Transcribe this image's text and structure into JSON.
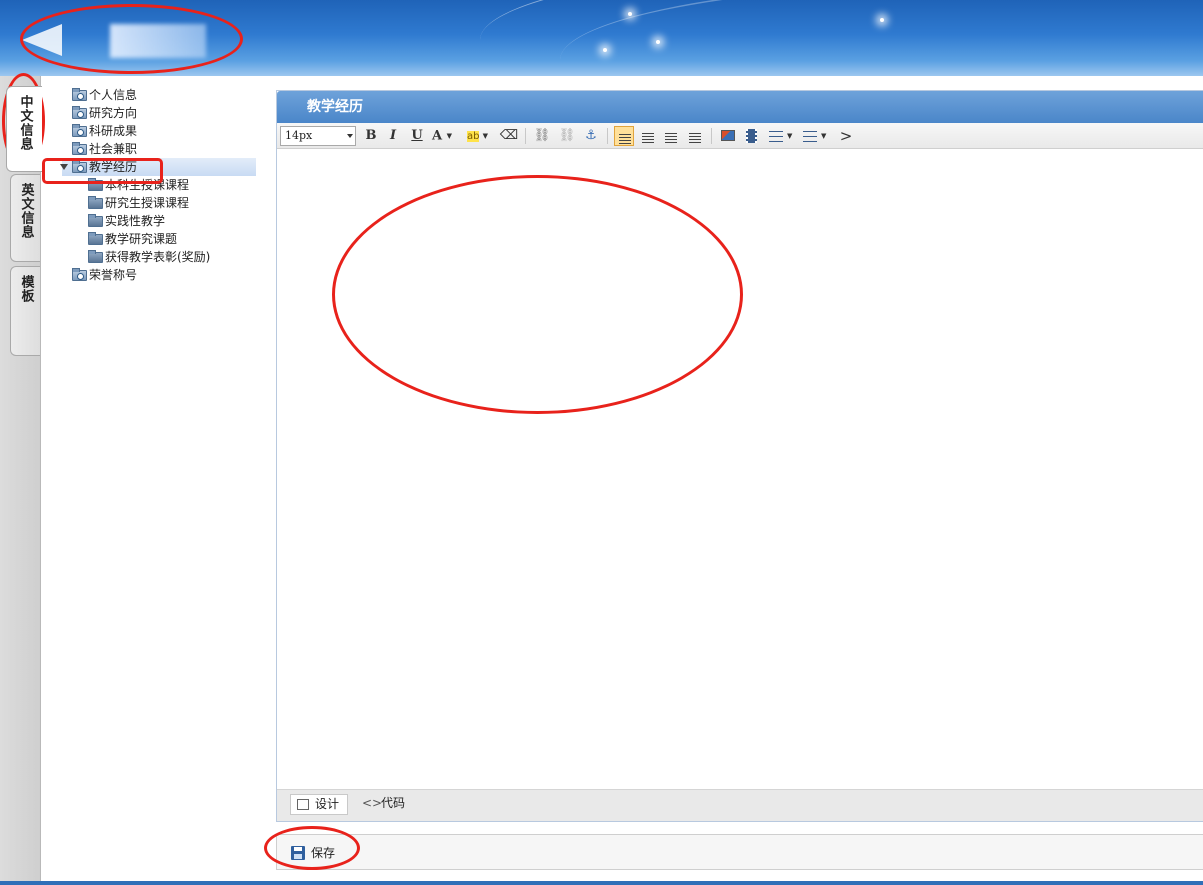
{
  "banner": {
    "logo_alt": "logo"
  },
  "vtabs": [
    {
      "label": "中文信息",
      "active": true
    },
    {
      "label": "英文信息",
      "active": false
    },
    {
      "label": "模板",
      "active": false
    }
  ],
  "tree": {
    "items": [
      {
        "label": "个人信息"
      },
      {
        "label": "研究方向"
      },
      {
        "label": "科研成果"
      },
      {
        "label": "社会兼职"
      },
      {
        "label": "教学经历",
        "selected": true,
        "expanded": true
      },
      {
        "label": "本科生授课课程"
      },
      {
        "label": "研究生授课课程"
      },
      {
        "label": "实践性教学"
      },
      {
        "label": "教学研究课题"
      },
      {
        "label": "获得教学表彰(奖励)"
      },
      {
        "label": "荣誉称号"
      }
    ]
  },
  "editor": {
    "title": "教学经历",
    "toolbar": {
      "font_size": "14px",
      "bold": "B",
      "italic": "I",
      "underline": "U",
      "font_color": "A",
      "highlight": "ab",
      "more": ">"
    },
    "modes": {
      "design": "设计",
      "code": "代码"
    }
  },
  "actions": {
    "save": "保存"
  },
  "colors": {
    "header_blue": "#4a86c9",
    "annotation_red": "#e8221b"
  }
}
